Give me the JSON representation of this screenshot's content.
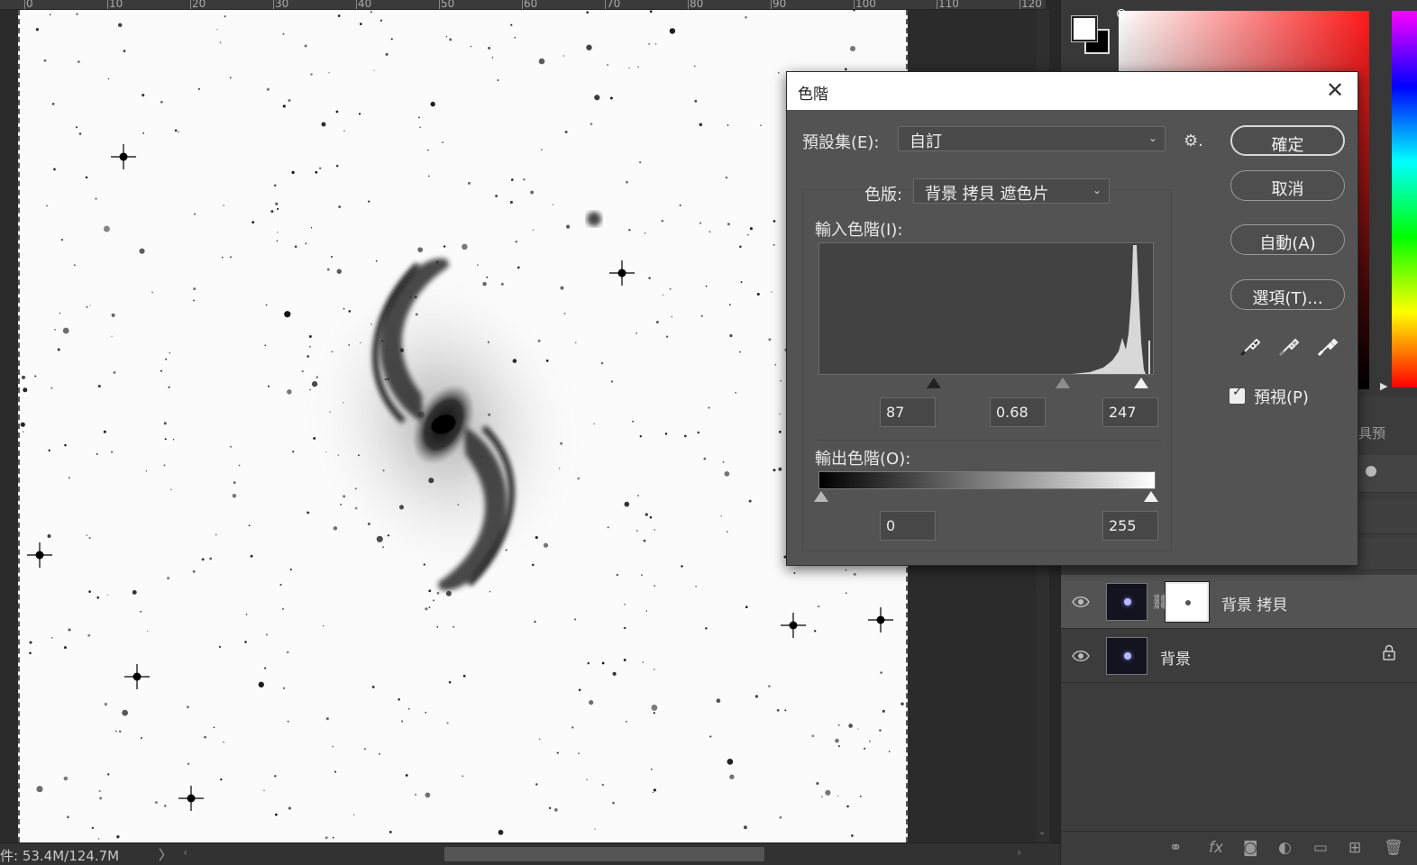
{
  "ruler": {
    "ticks": [
      "0",
      "10",
      "20",
      "30",
      "40",
      "50",
      "60",
      "70",
      "80",
      "90",
      "100",
      "110",
      "120"
    ]
  },
  "status": {
    "doc_size": "件: 53.4M/124.7M",
    "arrow": "〉"
  },
  "dialog": {
    "title": "色階",
    "close": "✕",
    "preset_label": "預設集(E):",
    "preset_value": "自訂",
    "channel_label": "色版:",
    "channel_value": "背景 拷貝 遮色片",
    "input_label": "輸入色階(I):",
    "output_label": "輸出色階(O):",
    "input_black": "87",
    "input_gamma": "0.68",
    "input_white": "247",
    "output_black": "0",
    "output_white": "255",
    "buttons": {
      "ok": "確定",
      "cancel": "取消",
      "auto": "自動(A)",
      "options": "選項(T)..."
    },
    "preview_label": "預視(P)",
    "preview_checked": true
  },
  "panels": {
    "properties_tab_partial": "具預"
  },
  "layers": [
    {
      "name": "背景 拷貝",
      "has_mask": true,
      "visible": true,
      "selected": true
    },
    {
      "name": "背景",
      "has_mask": false,
      "visible": true,
      "locked": true
    }
  ],
  "icons": {
    "gear": "gear-icon",
    "eye": "eye-icon",
    "lock": "lock-icon",
    "chain": "chain-icon"
  },
  "colors": {
    "foreground": "#ffffff",
    "background": "#000000",
    "dialog_bg": "#535353"
  }
}
